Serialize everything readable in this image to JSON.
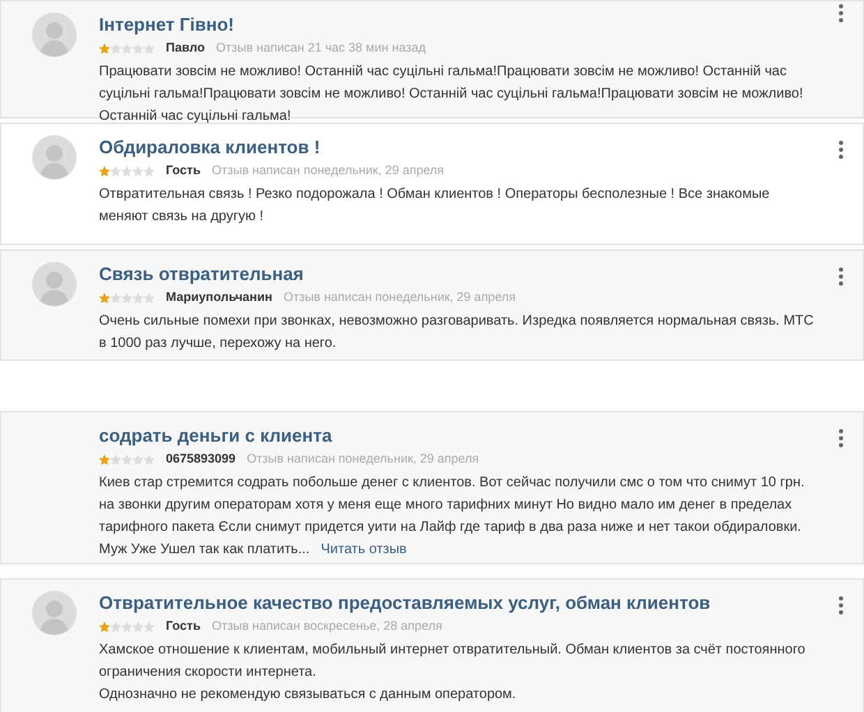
{
  "reviews": [
    {
      "title": "Інтернет Гівно!",
      "stars": 1,
      "author": "Павло",
      "date": "Отзыв написан 21 час 38 мин назад",
      "text": "Працювати зовсім не можливо! Останній час суцільні гальма!Працювати зовсім не можливо! Останній час суцільні гальма!Працювати зовсім не можливо! Останній час суцільні гальма!Працювати зовсім не можливо! Останній час суцільні гальма!",
      "avatar": true
    },
    {
      "title": "Обдираловка клиентов !",
      "stars": 1,
      "author": "Гость",
      "date": "Отзыв написан понедельник, 29 апреля",
      "text": "Отвратительная связь ! Резко подорожала ! Обман клиентов ! Операторы бесполезные ! Все знакомые меняют связь на другую !",
      "avatar": true
    },
    {
      "title": "Связь отвратительная",
      "stars": 1,
      "author": "Мариупольчанин",
      "date": "Отзыв написан понедельник, 29 апреля",
      "text": "Очень сильные помехи при звонках, невозможно разговаривать. Изредка появляется нормальная связь. МТС в 1000 раз лучше, перехожу на него.",
      "avatar": true
    },
    {
      "title": "содрать деньги с клиента",
      "stars": 1,
      "author": "0675893099",
      "date": "Отзыв написан понедельник, 29 апреля",
      "text": "Киев стар стремится содрать побольше денег с клиентов. Вот сейчас получили смс о том что снимут 10 грн. на звонки другим операторам хотя у меня еще много тарифних минут Но видно мало им денег в пределах тарифного пакета Єсли снимут придется уити на Лайф где тариф в два раза ниже и нет такои обдираловки. Муж Уже Ушел так как платить...",
      "read_more": "Читать отзыв",
      "avatar": false
    },
    {
      "title": "Отвратительное качество предоставляемых услуг, обман клиентов",
      "stars": 1,
      "author": "Гость",
      "date": "Отзыв написан воскресенье, 28 апреля",
      "text": "Хамское отношение к клиентам, мобильный интернет отвратительный. Обман клиентов за счёт постоянного ограничения скорости интернета.\nОднозначно не рекомендую связываться с данным оператором.",
      "avatar": true
    }
  ]
}
